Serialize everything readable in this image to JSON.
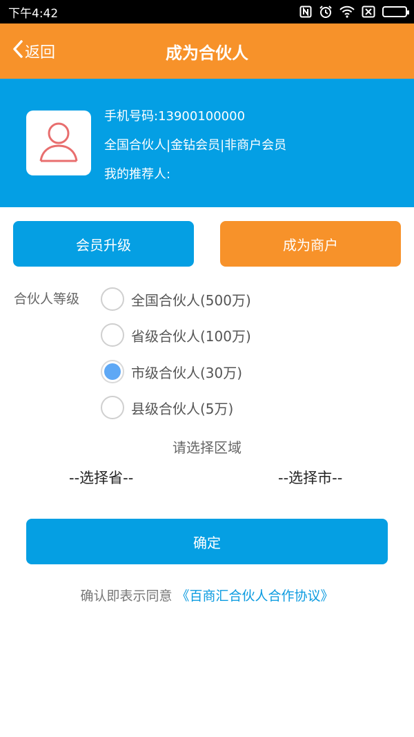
{
  "status_bar": {
    "time": "下午4:42",
    "icons": [
      "nfc-icon",
      "alarm-icon",
      "wifi-icon",
      "sim-off-icon",
      "battery-icon"
    ]
  },
  "header": {
    "back_label": "返回",
    "title": "成为合伙人"
  },
  "profile": {
    "phone": "手机号码:13900100000",
    "membership": "全国合伙人|金钻会员|非商户会员",
    "referrer": "我的推荐人:"
  },
  "actions": {
    "upgrade_label": "会员升级",
    "merchant_label": "成为商户"
  },
  "partner_level": {
    "label": "合伙人等级",
    "options": [
      {
        "label": "全国合伙人(500万)",
        "checked": false
      },
      {
        "label": "省级合伙人(100万)",
        "checked": false
      },
      {
        "label": "市级合伙人(30万)",
        "checked": true
      },
      {
        "label": "县级合伙人(5万)",
        "checked": false
      }
    ]
  },
  "region": {
    "title": "请选择区域",
    "province": "--选择省--",
    "city": "--选择市--"
  },
  "confirm_label": "确定",
  "agreement": {
    "prefix": "确认即表示同意",
    "link": "《百商汇合伙人合作协议》"
  },
  "colors": {
    "orange": "#f7922a",
    "blue": "#059fe3",
    "radio_checked": "#5ea8f5"
  }
}
